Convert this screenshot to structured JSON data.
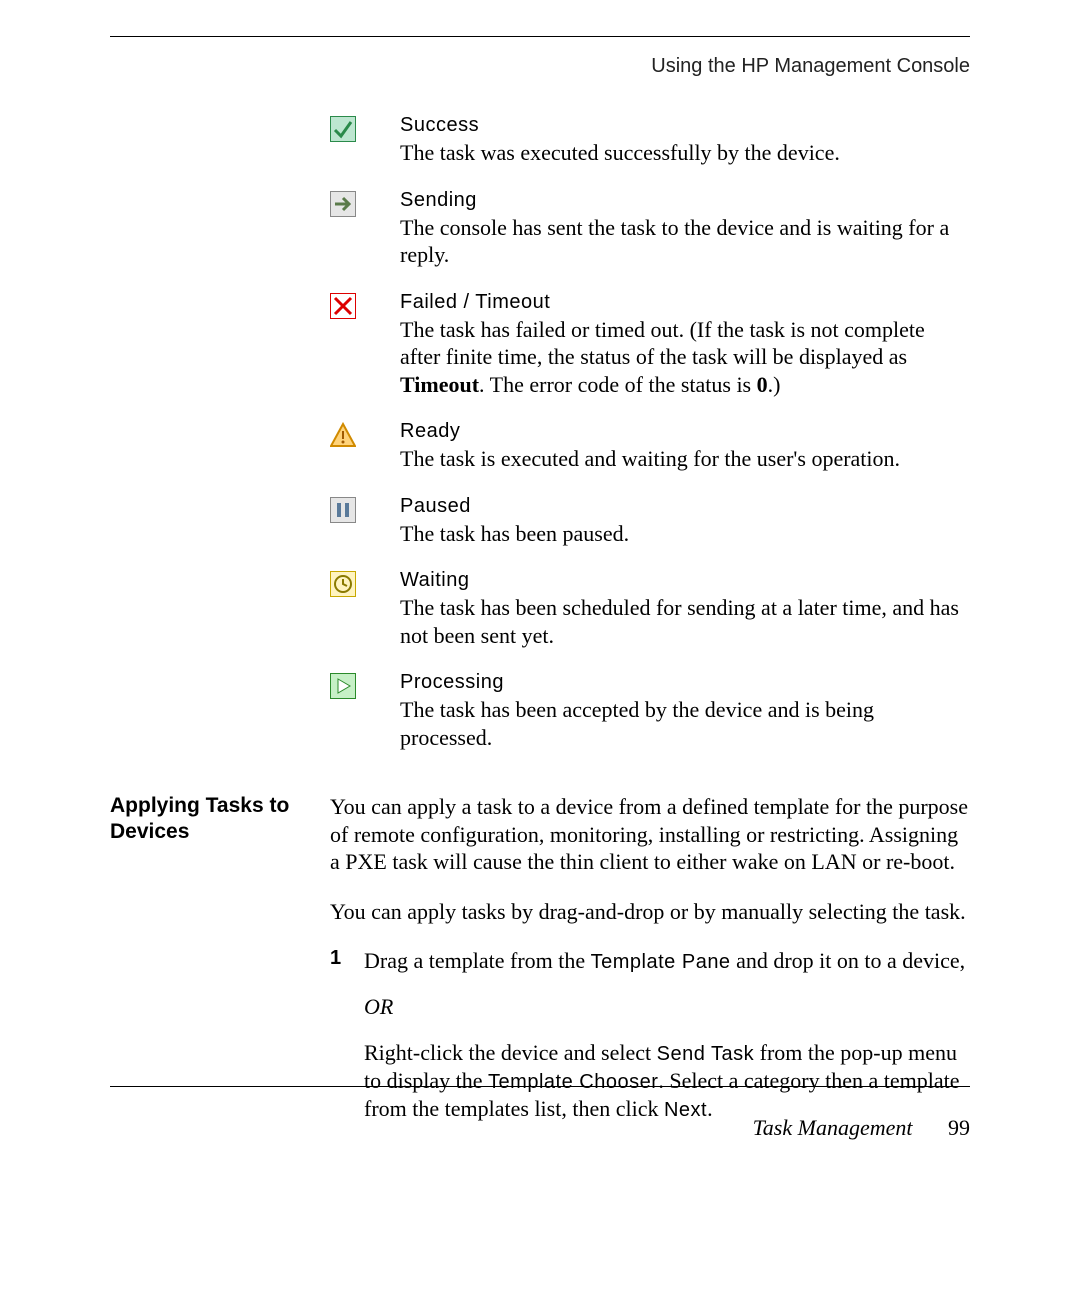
{
  "header": "Using the HP Management Console",
  "statuses": {
    "success": {
      "title": "Success",
      "desc": "The task was executed successfully by the device."
    },
    "sending": {
      "title": "Sending",
      "desc": "The console has sent the task to the device and is waiting for a reply."
    },
    "failed": {
      "title": "Failed / Timeout",
      "desc_pre": "The task has failed or timed out. (If the task is not complete after finite time, the status of the task will be displayed as ",
      "bold1": "Timeout",
      "desc_mid": ". The error code of the status is ",
      "bold2": "0",
      "desc_post": ".)"
    },
    "ready": {
      "title": "Ready",
      "desc": "The task is executed and waiting for the user's operation."
    },
    "paused": {
      "title": "Paused",
      "desc": "The task has been paused."
    },
    "waiting": {
      "title": "Waiting",
      "desc": "The task has been scheduled for sending at a later time, and has not been sent yet."
    },
    "processing": {
      "title": "Processing",
      "desc": "The task has been accepted by the device and is being processed."
    }
  },
  "section_heading": "Applying Tasks to Devices",
  "para1": "You can apply a task to a device from a defined template for the purpose of remote configuration, monitoring, installing or restricting. Assigning a PXE task will cause the thin client to either wake on LAN or re-boot.",
  "para2": "You can apply tasks by drag-and-drop or by manually selecting the task.",
  "step1_num": "1",
  "step1_pre": "Drag a template from the ",
  "step1_ui1": "Template Pane",
  "step1_post": " and drop it on to a device,",
  "or": "OR",
  "step1b_pre": "Right-click the device and select ",
  "step1b_ui1": "Send Task",
  "step1b_mid1": " from the pop-up menu to display the ",
  "step1b_ui2": "Template Chooser",
  "step1b_mid2": ". Select a category then a template from the templates list, then click ",
  "step1b_ui3": "Next",
  "step1b_post": ".",
  "footer_section": "Task Management",
  "footer_page": "99"
}
